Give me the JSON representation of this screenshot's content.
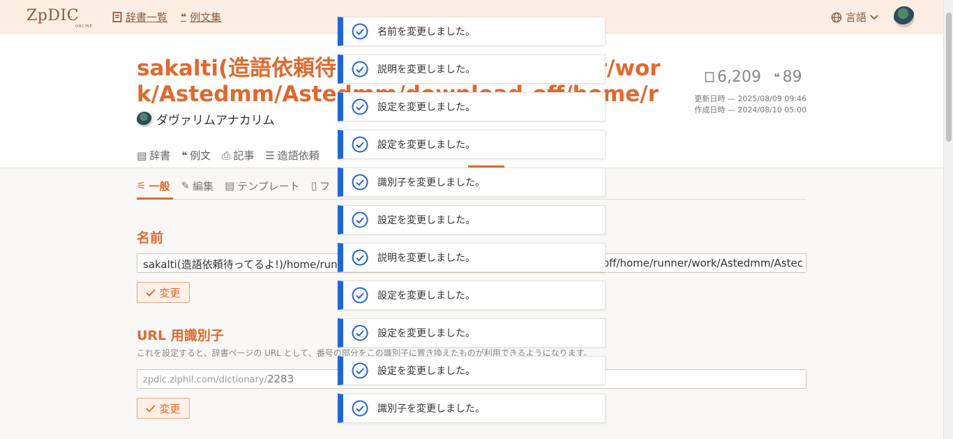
{
  "header": {
    "logo": "ZpDIC",
    "logo_sub": "ONLINE",
    "nav": [
      "辞書一覧",
      "例文集"
    ],
    "lang_label": "言語"
  },
  "dictionary": {
    "title": "sakalti(造語依頼待ってるよ!)/home/runner/work/Astedmm/Astedmm/download-off/home/runner/work/Astedmm/Astedmm",
    "owner": "ダヴァリムアナカリム",
    "word_count": "6,209",
    "example_count": "89",
    "updated": "更新日時 — 2025/08/09 09:46",
    "created": "作成日時 — 2024/08/10 05:00"
  },
  "tabs": [
    "辞書",
    "例文",
    "記事",
    "造語依頼"
  ],
  "subtabs": [
    "一般",
    "編集",
    "テンプレート",
    "フ"
  ],
  "settings": {
    "name_heading": "名前",
    "name_value_left": "sakalti(造語依頼待ってるよ!)/home/runn",
    "name_value_right": "off/home/runner/work/Astedmm/Astec",
    "change_label": "変更",
    "url_heading": "URL 用識別子",
    "url_desc": "これを設定すると、辞書ページの URL として、番号の部分をこの識別子に置き換えたものが利用できるようになります。",
    "url_prefix": "zpdic.ziphil.com/dictionary/",
    "url_placeholder": "2283"
  },
  "toasts": [
    "名前を変更しました。",
    "説明を変更しました。",
    "設定を変更しました。",
    "設定を変更しました。",
    "識別子を変更しました。",
    "設定を変更しました。",
    "説明を変更しました。",
    "設定を変更しました。",
    "設定を変更しました。",
    "設定を変更しました。",
    "識別子を変更しました。"
  ],
  "colors": {
    "accent": "#e0692e",
    "toast_bar": "#1f66d9",
    "header_bg": "#fdeee3"
  }
}
